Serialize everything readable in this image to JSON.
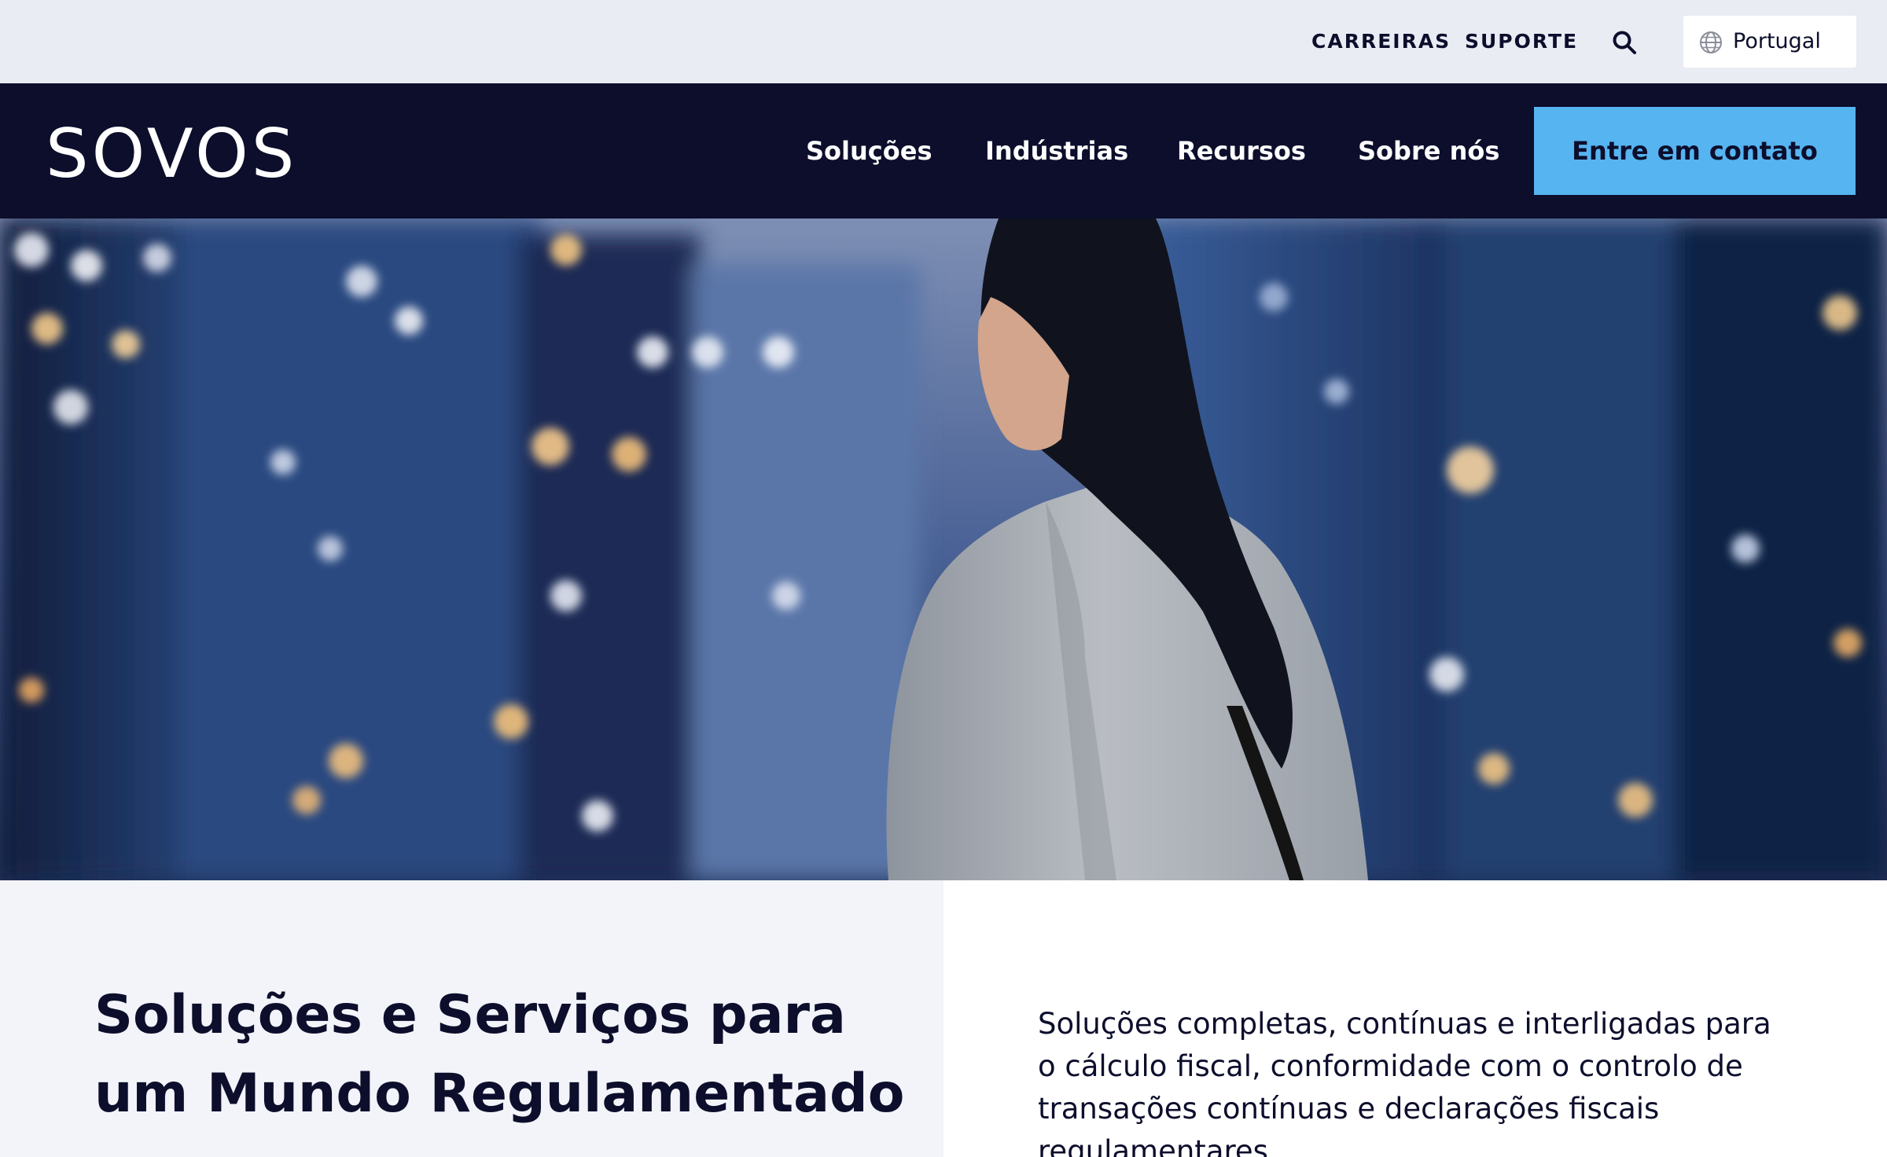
{
  "utility_bar": {
    "links": [
      "CARREIRAS",
      "SUPORTE"
    ],
    "search_icon": "search-icon",
    "language": {
      "icon": "globe-icon",
      "selected": "Portugal"
    }
  },
  "header": {
    "logo": "SOVOS",
    "nav": [
      "Soluções",
      "Indústrias",
      "Recursos",
      "Sobre nós"
    ],
    "cta_label": "Entre em contato"
  },
  "colors": {
    "navy": "#0c0e2c",
    "accent": "#56b4f0",
    "utility_bg": "#e9ecf2",
    "panel_bg": "#f2f4f9"
  },
  "main": {
    "headline": "Soluções e Serviços para um Mundo Regulamentado",
    "description": "Soluções completas, contínuas e interligadas para o cálculo fiscal, conformidade com o controlo de transações contínuas e declarações fiscais regulamentares."
  }
}
